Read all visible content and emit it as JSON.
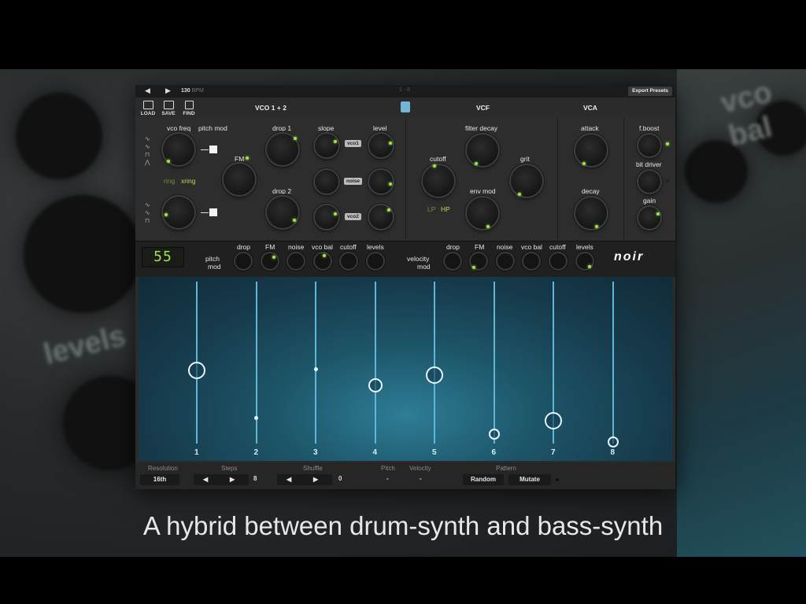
{
  "topbar": {
    "prev": "◀",
    "next": "▶",
    "bpm_value": "130",
    "bpm_unit": "BPM",
    "export_label": "Export Presets",
    "mid": "1 - 8"
  },
  "file": {
    "load": "LOAD",
    "save": "SAVE",
    "find": "FIND"
  },
  "sections": {
    "vco": "VCO 1 + 2",
    "vcf": "VCF",
    "vca": "VCA"
  },
  "vco": {
    "vco_freq": "vco freq",
    "pitch_mod": "pitch mod",
    "ring": "ring",
    "xring": "xring",
    "fm": "FM",
    "drop1": "drop 1",
    "drop2": "drop 2",
    "slope": "slope",
    "level": "level",
    "tags": [
      "vco1",
      "noise",
      "vco2"
    ]
  },
  "vcf": {
    "cutoff": "cutoff",
    "filter_decay": "filter decay",
    "grit": "grit",
    "env_mod": "env mod",
    "lp": "LP",
    "hp": "HP"
  },
  "vca": {
    "attack": "attack",
    "decay": "decay"
  },
  "extra": {
    "fboost": "f.boost",
    "bit_driver": "bit driver",
    "gain": "gain"
  },
  "modrow": {
    "lcd": "55",
    "pitch_mod": [
      "pitch",
      "mod"
    ],
    "velocity_mod": [
      "velocity",
      "mod"
    ],
    "targets": [
      "drop",
      "FM",
      "noise",
      "vco bal",
      "cutoff",
      "levels"
    ],
    "brand": "noir"
  },
  "sequencer": {
    "steps": [
      {
        "label": "1",
        "level": 0.45,
        "size": "large"
      },
      {
        "label": "2",
        "level": 0.16,
        "size": "dot"
      },
      {
        "label": "3",
        "level": 0.46,
        "size": "small"
      },
      {
        "label": "4",
        "level": 0.36,
        "size": "medium"
      },
      {
        "label": "5",
        "level": 0.42,
        "size": "large"
      },
      {
        "label": "6",
        "level": 0.06,
        "size": "medium-small"
      },
      {
        "label": "7",
        "level": 0.14,
        "size": "large"
      },
      {
        "label": "8",
        "level": 0.01,
        "size": "medium-small"
      }
    ]
  },
  "bottom": {
    "resolution_label": "Resolution",
    "resolution_value": "16th",
    "steps_label": "Steps",
    "steps_value": "8",
    "shuffle_label": "Shuffle",
    "shuffle_value": "0",
    "pitch_label": "Pitch",
    "pitch_value": "-",
    "velocity_label": "Velocity",
    "velocity_value": "-",
    "pattern_label": "Pattern",
    "random": "Random",
    "mutate": "Mutate",
    "prev": "◀",
    "next": "▶"
  },
  "caption": "A hybrid between drum-synth and bass-synth",
  "colors": {
    "accent": "#9fe34f",
    "seq_line": "#5fb6d6"
  }
}
